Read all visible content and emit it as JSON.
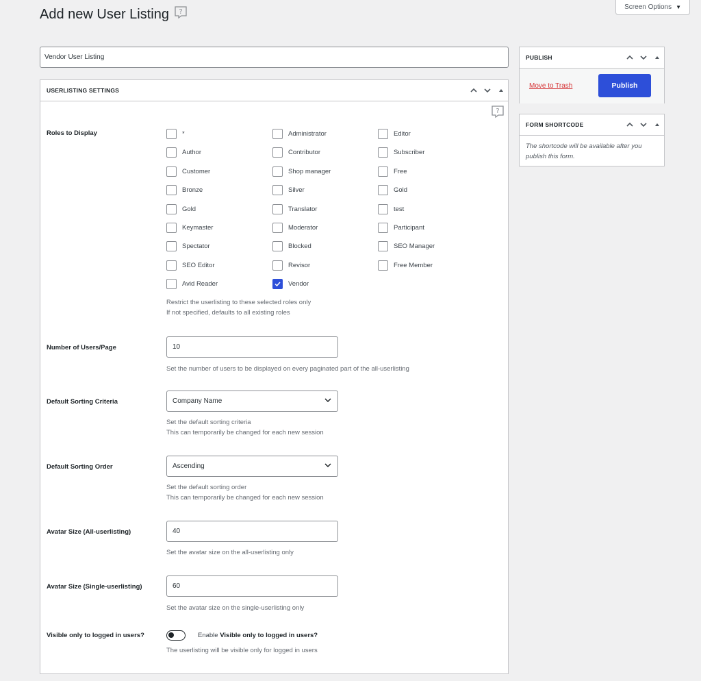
{
  "page": {
    "title": "Add new User Listing",
    "screen_options": "Screen Options"
  },
  "post_title": "Vendor User Listing",
  "settings": {
    "box_title": "USERLISTING SETTINGS",
    "roles_label": "Roles to Display",
    "roles": [
      {
        "label": "*",
        "checked": false
      },
      {
        "label": "Administrator",
        "checked": false
      },
      {
        "label": "Editor",
        "checked": false
      },
      {
        "label": "Author",
        "checked": false
      },
      {
        "label": "Contributor",
        "checked": false
      },
      {
        "label": "Subscriber",
        "checked": false
      },
      {
        "label": "Customer",
        "checked": false
      },
      {
        "label": "Shop manager",
        "checked": false
      },
      {
        "label": "Free",
        "checked": false
      },
      {
        "label": "Bronze",
        "checked": false
      },
      {
        "label": "Silver",
        "checked": false
      },
      {
        "label": "Gold",
        "checked": false
      },
      {
        "label": "Gold",
        "checked": false
      },
      {
        "label": "Translator",
        "checked": false
      },
      {
        "label": "test",
        "checked": false
      },
      {
        "label": "Keymaster",
        "checked": false
      },
      {
        "label": "Moderator",
        "checked": false
      },
      {
        "label": "Participant",
        "checked": false
      },
      {
        "label": "Spectator",
        "checked": false
      },
      {
        "label": "Blocked",
        "checked": false
      },
      {
        "label": "SEO Manager",
        "checked": false
      },
      {
        "label": "SEO Editor",
        "checked": false
      },
      {
        "label": "Revisor",
        "checked": false
      },
      {
        "label": "Free Member",
        "checked": false
      },
      {
        "label": "Avid Reader",
        "checked": false
      },
      {
        "label": "Vendor",
        "checked": true
      }
    ],
    "roles_desc_1": "Restrict the userlisting to these selected roles only",
    "roles_desc_2": "If not specified, defaults to all existing roles",
    "users_per_page_label": "Number of Users/Page",
    "users_per_page_value": "10",
    "users_per_page_desc": "Set the number of users to be displayed on every paginated part of the all-userlisting",
    "sort_criteria_label": "Default Sorting Criteria",
    "sort_criteria_value": "Company Name",
    "sort_criteria_desc_1": "Set the default sorting criteria",
    "sort_criteria_desc_2": "This can temporarily be changed for each new session",
    "sort_order_label": "Default Sorting Order",
    "sort_order_value": "Ascending",
    "sort_order_desc_1": "Set the default sorting order",
    "sort_order_desc_2": "This can temporarily be changed for each new session",
    "avatar_all_label": "Avatar Size (All-userlisting)",
    "avatar_all_value": "40",
    "avatar_all_desc": "Set the avatar size on the all-userlisting only",
    "avatar_single_label": "Avatar Size (Single-userlisting)",
    "avatar_single_value": "60",
    "avatar_single_desc": "Set the avatar size on the single-userlisting only",
    "visible_label": "Visible only to logged in users?",
    "visible_enable_prefix": "Enable ",
    "visible_enable_bold": "Visible only to logged in users?",
    "visible_desc": "The userlisting will be visible only for logged in users",
    "visible_on": false
  },
  "publish": {
    "title": "PUBLISH",
    "trash_label": "Move to Trash",
    "publish_label": "Publish"
  },
  "shortcode": {
    "title": "FORM SHORTCODE",
    "text": "The shortcode will be available after you publish this form."
  },
  "colors": {
    "accent": "#2d4fd9",
    "danger": "#d63638",
    "background": "#f0f0f1"
  }
}
